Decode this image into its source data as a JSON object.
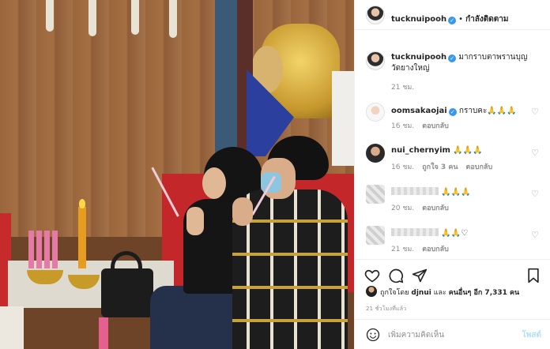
{
  "header": {
    "username": "tucknuipooh",
    "follow_status": "กำลังติดตาม"
  },
  "caption": {
    "username": "tucknuipooh",
    "text": "มากราบตาพรานบุญ วัดยางใหญ่",
    "time": "21 ชม."
  },
  "comments": [
    {
      "username": "oomsakaojai",
      "verified": true,
      "text": "กราบคะ🙏🙏🙏",
      "time": "16 ชม.",
      "likes": "",
      "reply": "ตอบกลับ"
    },
    {
      "username": "nui_chernyim",
      "verified": false,
      "text": "🙏🙏🙏",
      "time": "16 ชม.",
      "likes": "ถูกใจ 3 คน",
      "reply": "ตอบกลับ"
    },
    {
      "username": "",
      "verified": false,
      "text": "🙏🙏🙏",
      "time": "20 ชม.",
      "likes": "",
      "reply": "ตอบกลับ"
    },
    {
      "username": "",
      "verified": false,
      "text": "🙏🙏♡",
      "time": "21 ชม.",
      "likes": "",
      "reply": "ตอบกลับ"
    }
  ],
  "liked": {
    "prefix": "ถูกใจโดย",
    "user": "djnui",
    "and": "และ",
    "others": "คนอื่นๆ อีก 7,331 คน"
  },
  "post_time": "21 ชั่วโมงที่แล้ว",
  "add_comment": {
    "placeholder": "เพิ่มความคิดเห็น",
    "post_label": "โพสต์"
  },
  "icons": {
    "like": "heart-icon",
    "comment": "comment-icon",
    "share": "share-icon",
    "save": "bookmark-icon",
    "emoji": "emoji-icon"
  },
  "colors": {
    "verified": "#3897f0",
    "muted": "#8e8e8e",
    "post_button": "#b2dffc"
  }
}
